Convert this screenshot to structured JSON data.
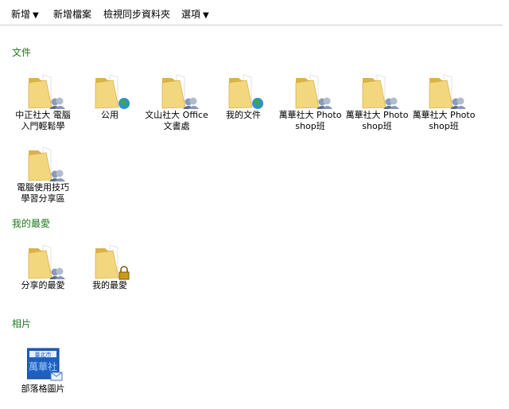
{
  "toolbar": {
    "new_label": "新增",
    "new_file_label": "新增檔案",
    "sync_label": "檢視同步資料夾",
    "options_label": "選項",
    "dropdown_glyph": "▼"
  },
  "sections": {
    "documents": {
      "title": "文件",
      "items": [
        {
          "label": "中正社大 電腦入門輕鬆學",
          "icon": "shared-folder-icon"
        },
        {
          "label": "公用",
          "icon": "public-folder-icon"
        },
        {
          "label": "文山社大 Office文書處",
          "icon": "shared-folder-icon"
        },
        {
          "label": "我的文件",
          "icon": "public-folder-icon"
        },
        {
          "label": "萬華社大 Photoshop班",
          "icon": "shared-folder-icon"
        },
        {
          "label": "萬華社大 Photoshop班",
          "icon": "shared-folder-icon"
        },
        {
          "label": "萬華社大 Photoshop班",
          "icon": "shared-folder-icon"
        },
        {
          "label": "電腦使用技巧 學習分享區",
          "icon": "shared-folder-icon"
        }
      ]
    },
    "favorites": {
      "title": "我的最愛",
      "items": [
        {
          "label": "分享的最愛",
          "icon": "shared-folder-icon"
        },
        {
          "label": "我的最愛",
          "icon": "locked-folder-icon"
        }
      ]
    },
    "photos": {
      "title": "相片",
      "items": [
        {
          "label": "部落格圖片",
          "icon": "blog-album-icon",
          "thumb_top": "臺北市",
          "thumb_main": "萬華社"
        }
      ]
    }
  },
  "colors": {
    "section_title": "#1a7a1a",
    "folder": "#f3d77e",
    "folder_dark": "#d9b24a"
  }
}
